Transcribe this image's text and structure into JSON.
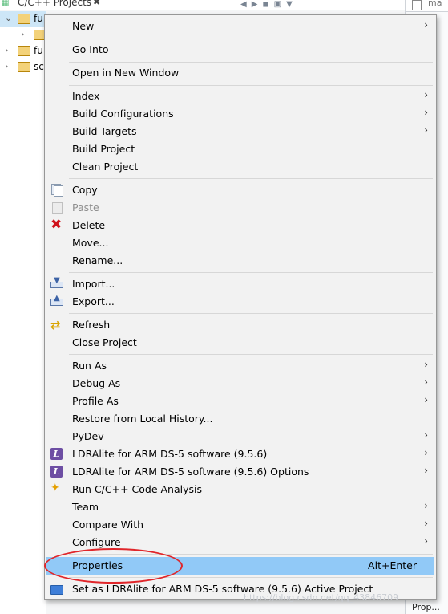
{
  "background": {
    "view_tab": {
      "title": "C/C++ Projects",
      "close": "✖"
    },
    "tree": [
      {
        "chev": "⌄",
        "label": "fu",
        "selected": true
      },
      {
        "chev": "›",
        "label": "",
        "selected": false
      },
      {
        "chev": "›",
        "label": "fu",
        "selected": false
      },
      {
        "chev": "›",
        "label": "sc",
        "selected": false
      }
    ],
    "right_panel": {
      "tab_label": "ma",
      "bottom_label": "Prop..."
    },
    "watermark": "https://blog.csdn.net/qq_43846709"
  },
  "menu": {
    "items": [
      {
        "label": "New",
        "submenu": true
      },
      {
        "label": "Go Into"
      },
      {
        "label": "Open in New Window"
      },
      {
        "label": "Index",
        "submenu": true
      },
      {
        "label": "Build Configurations",
        "submenu": true
      },
      {
        "label": "Build Targets",
        "submenu": true
      },
      {
        "label": "Build Project"
      },
      {
        "label": "Clean Project"
      },
      {
        "label": "Copy",
        "icon": "copy-icon"
      },
      {
        "label": "Paste",
        "icon": "paste-icon",
        "disabled": true
      },
      {
        "label": "Delete",
        "icon": "delete-icon"
      },
      {
        "label": "Move..."
      },
      {
        "label": "Rename..."
      },
      {
        "label": "Import...",
        "icon": "import-icon"
      },
      {
        "label": "Export...",
        "icon": "export-icon"
      },
      {
        "label": "Refresh",
        "icon": "refresh-icon"
      },
      {
        "label": "Close Project"
      },
      {
        "label": "Run As",
        "submenu": true
      },
      {
        "label": "Debug As",
        "submenu": true
      },
      {
        "label": "Profile As",
        "submenu": true
      },
      {
        "label": "Restore from Local History..."
      },
      {
        "label": "PyDev",
        "submenu": true
      },
      {
        "label": "LDRAlite for ARM DS-5 software (9.5.6)",
        "icon": "ldra-icon",
        "submenu": true
      },
      {
        "label": "LDRAlite for ARM DS-5 software (9.5.6) Options",
        "icon": "ldra-icon",
        "submenu": true
      },
      {
        "label": "Run C/C++ Code Analysis",
        "icon": "code-analysis-icon"
      },
      {
        "label": "Team",
        "submenu": true
      },
      {
        "label": "Compare With",
        "submenu": true
      },
      {
        "label": "Configure",
        "submenu": true
      },
      {
        "label": "Properties",
        "accelerator": "Alt+Enter",
        "highlighted": true
      },
      {
        "label": "Set as LDRAlite for ARM DS-5 software (9.5.6) Active Project",
        "icon": "project-icon"
      }
    ]
  },
  "colors": {
    "menu_bg": "#f2f2f2",
    "highlight": "#91c9f7",
    "annotation": "#e0262a",
    "disabled_text": "#8e8e8e"
  }
}
